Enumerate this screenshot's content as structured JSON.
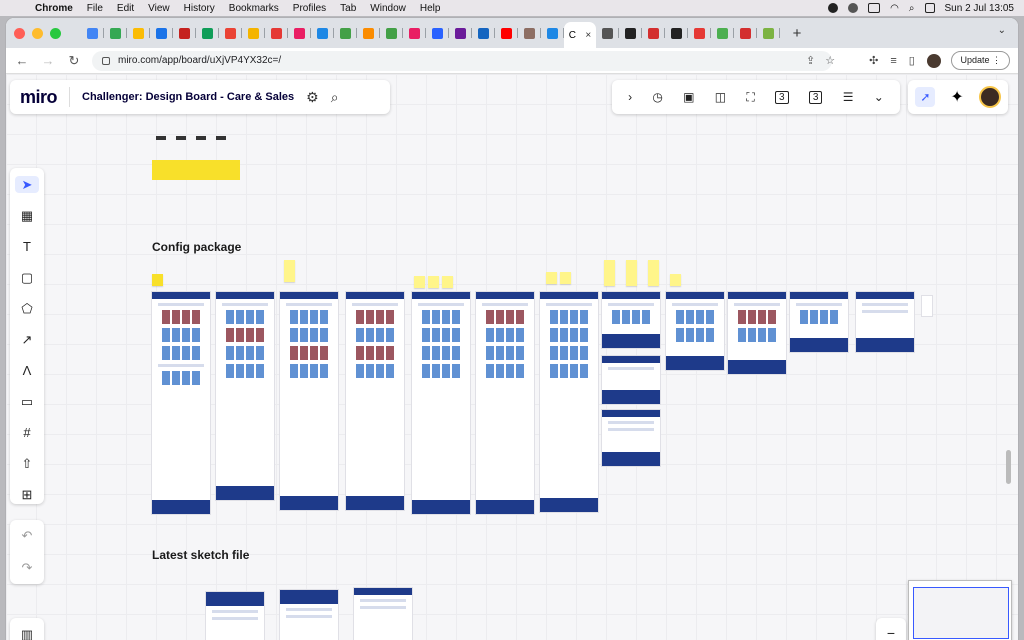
{
  "menubar": {
    "app": "Chrome",
    "items": [
      "File",
      "Edit",
      "View",
      "History",
      "Bookmarks",
      "Profiles",
      "Tab",
      "Window",
      "Help"
    ],
    "clock": "Sun 2 Jul  13:05"
  },
  "browser": {
    "tab_favicon_colors": [
      "#4285f4",
      "#34a853",
      "#fbbc04",
      "#1a73e8",
      "#c5221f",
      "#0f9d58",
      "#ea4335",
      "#f4b400",
      "#e53935",
      "#e91e63",
      "#1e88e5",
      "#43a047",
      "#fb8c00",
      "#43a047",
      "#e91e63",
      "#2962ff",
      "#6a1b9a",
      "#1565c0",
      "#ff0000",
      "#8d6e63",
      "#1e88e5",
      "#555555",
      "#222222",
      "#d32f2f",
      "#222222",
      "#e53935",
      "#4caf50",
      "#d32f2f",
      "#7cb342"
    ],
    "active_tab_label": "C",
    "active_tab_close": "×",
    "new_tab": "+",
    "tab_menu": "⌄",
    "url": "miro.com/app/board/uXjVP4YX32c=/",
    "update_label": "Update"
  },
  "miro": {
    "logo": "miro",
    "board_title": "Challenger: Design Board - Care & Sales",
    "counter_a": "3",
    "counter_b": "3",
    "sections": {
      "config": "Config package",
      "sketch": "Latest sketch file"
    },
    "zoom_out": "−"
  }
}
